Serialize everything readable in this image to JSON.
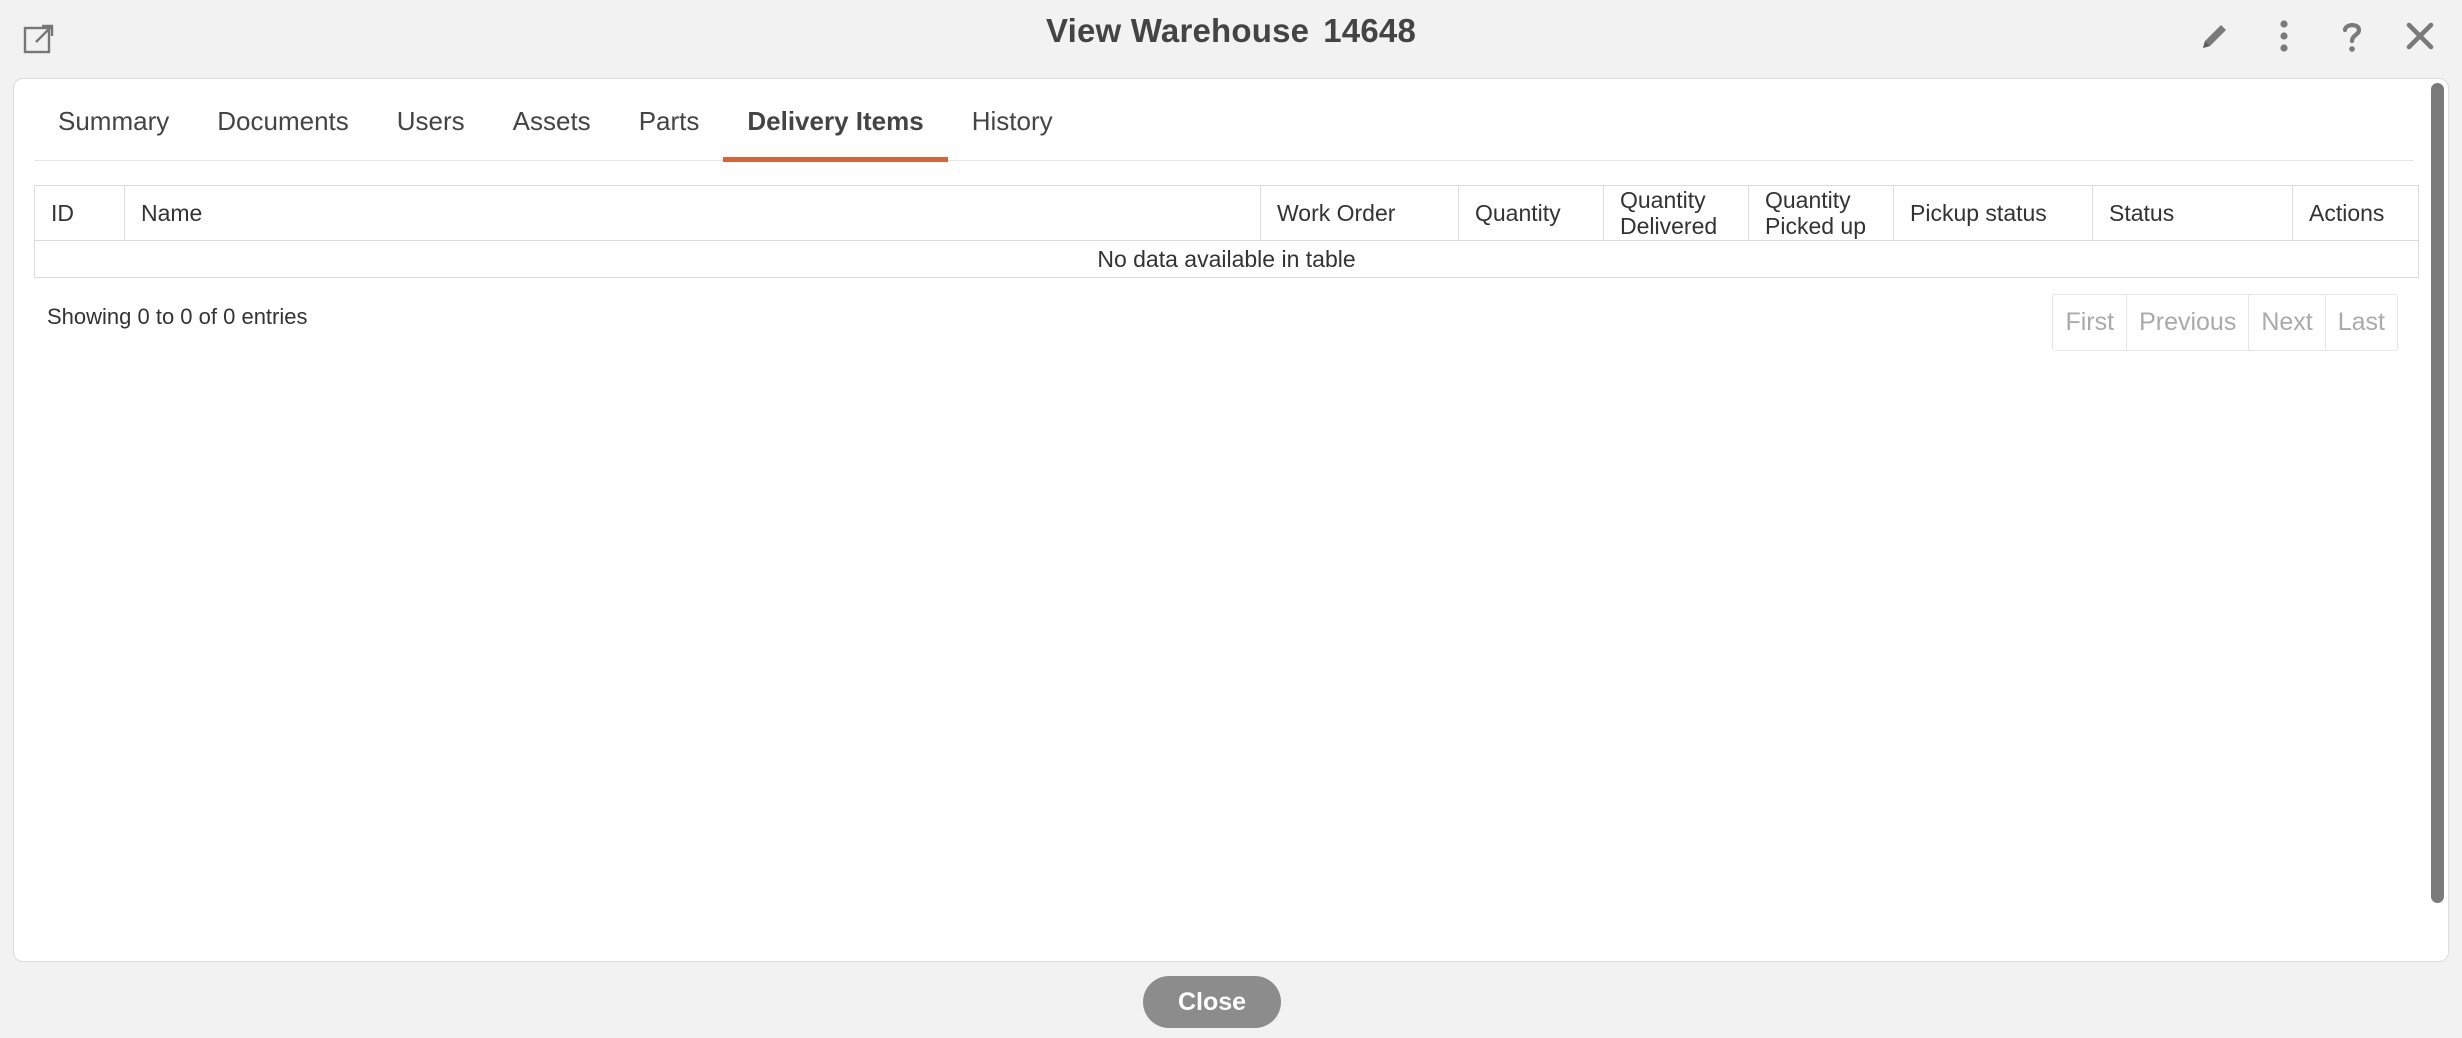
{
  "header": {
    "title": "View Warehouse",
    "warehouse_number": "14648",
    "icons": [
      "popout-icon",
      "pencil-icon",
      "more-vertical-icon",
      "help-icon",
      "close-icon"
    ]
  },
  "tabs": [
    {
      "label": "Summary",
      "active": false
    },
    {
      "label": "Documents",
      "active": false
    },
    {
      "label": "Users",
      "active": false
    },
    {
      "label": "Assets",
      "active": false
    },
    {
      "label": "Parts",
      "active": false
    },
    {
      "label": "Delivery Items",
      "active": true
    },
    {
      "label": "History",
      "active": false
    }
  ],
  "table": {
    "columns": [
      {
        "line1": "ID",
        "line2": ""
      },
      {
        "line1": "Name",
        "line2": ""
      },
      {
        "line1": "Work Order",
        "line2": ""
      },
      {
        "line1": "Quantity",
        "line2": ""
      },
      {
        "line1": "Quantity",
        "line2": "Delivered"
      },
      {
        "line1": "Quantity",
        "line2": "Picked up"
      },
      {
        "line1": "Pickup status",
        "line2": ""
      },
      {
        "line1": "Status",
        "line2": ""
      },
      {
        "line1": "Actions",
        "line2": ""
      }
    ],
    "empty_message": "No data available in table",
    "info": "Showing 0 to 0 of 0 entries"
  },
  "pagination": {
    "first": "First",
    "previous": "Previous",
    "next": "Next",
    "last": "Last"
  },
  "footer": {
    "close_label": "Close"
  },
  "colors": {
    "accent": "#d9643a",
    "background": "#f2f2f2",
    "close_button": "#8c8c8c"
  }
}
